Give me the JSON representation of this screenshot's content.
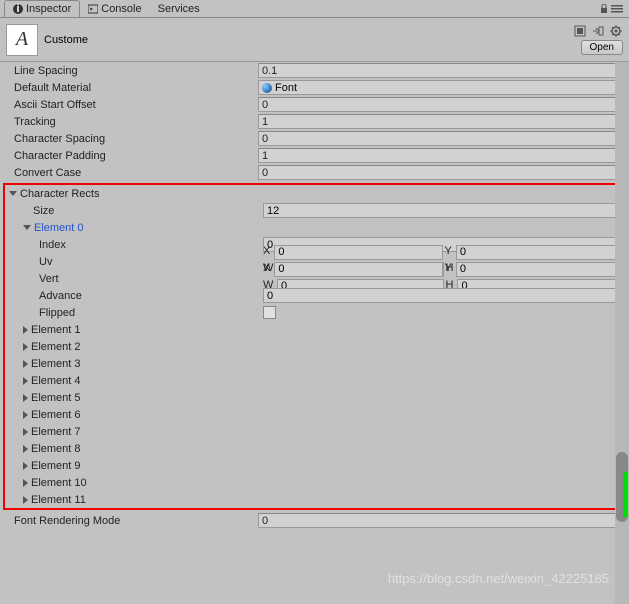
{
  "tabs": {
    "inspector": "Inspector",
    "console": "Console",
    "services": "Services"
  },
  "header": {
    "title": "Custome",
    "open": "Open"
  },
  "props": {
    "lineSpacing": {
      "label": "Line Spacing",
      "value": "0.1"
    },
    "defaultMaterial": {
      "label": "Default Material",
      "value": "Font"
    },
    "asciiStartOffset": {
      "label": "Ascii Start Offset",
      "value": "0"
    },
    "tracking": {
      "label": "Tracking",
      "value": "1"
    },
    "characterSpacing": {
      "label": "Character Spacing",
      "value": "0"
    },
    "characterPadding": {
      "label": "Character Padding",
      "value": "1"
    },
    "convertCase": {
      "label": "Convert Case",
      "value": "0"
    },
    "fontRenderingMode": {
      "label": "Font Rendering Mode",
      "value": "0"
    }
  },
  "characterRects": {
    "label": "Character Rects",
    "sizeLabel": "Size",
    "sizeValue": "12",
    "element0": {
      "label": "Element 0",
      "index": {
        "label": "Index",
        "value": "0"
      },
      "uv": {
        "label": "Uv",
        "x": "0",
        "y": "0",
        "w": "0",
        "h": "0"
      },
      "vert": {
        "label": "Vert",
        "x": "0",
        "y": "0",
        "w": "0",
        "h": "0"
      },
      "advance": {
        "label": "Advance",
        "value": "0"
      },
      "flipped": {
        "label": "Flipped"
      }
    },
    "elements": [
      "Element 1",
      "Element 2",
      "Element 3",
      "Element 4",
      "Element 5",
      "Element 6",
      "Element 7",
      "Element 8",
      "Element 9",
      "Element 10",
      "Element 11"
    ]
  },
  "xywh": {
    "x": "X",
    "y": "Y",
    "w": "W",
    "h": "H"
  },
  "watermark": "https://blog.csdn.net/weixin_42225185"
}
